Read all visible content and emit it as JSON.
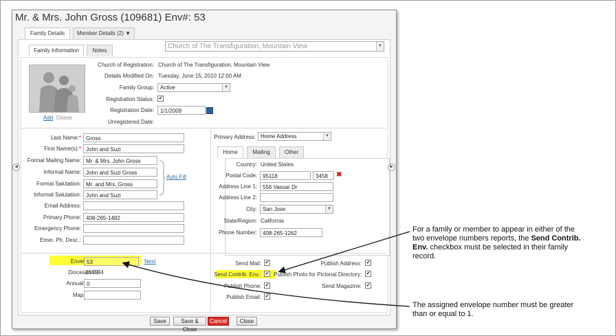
{
  "dialog": {
    "title": "Mr. & Mrs. John Gross (109681) Env#: 53",
    "tabs": [
      "Family Details",
      "Member Details (2)"
    ],
    "member_tab_caret": "▼",
    "subtabs": [
      "Family Information",
      "Notes"
    ],
    "church_select": "Church of The Transfiguration, Mountain View"
  },
  "registration": {
    "photo_links": [
      "Add",
      "Delete"
    ],
    "church_label": "Church of Registration:",
    "church_value": "Church of The Transfiguration, Mountain View",
    "modified_label": "Details Modified On:",
    "modified_value": "Tuesday, June 15, 2010 12:00 AM",
    "group_label": "Family Group:",
    "group_value": "Active",
    "status_label": "Registration Status:",
    "date_label": "Registration Date:",
    "date_value": "1/1/2009",
    "unreg_label": "Unregistered Date:"
  },
  "names": {
    "last_label": "Last Name:",
    "last_value": "Gross",
    "first_label": "First Name(s):",
    "first_value": "John and Suzi",
    "formal_mailing_label": "Formal Mailing Name:",
    "formal_mailing_value": "Mr. & Mrs. John Gross",
    "informal_name_label": "Informal Name:",
    "informal_name_value": "John and Suzi Gross",
    "formal_salutation_label": "Formal Salutation:",
    "formal_salutation_value": "Mr. and Mrs. Gross",
    "informal_salutation_label": "Informal Salutation:",
    "informal_salutation_value": "John and Suzi",
    "auto_fill": "Auto Fill",
    "email_label": "Email Address:",
    "phone_label": "Primary Phone:",
    "phone_value": "408-265-1482",
    "emergency_label": "Emergency Phone:",
    "emer_desc_label": "Emer. Ph. Desc.:"
  },
  "address": {
    "primary_label": "Primary Address:",
    "primary_value": "Home Address",
    "tabs": [
      "Home",
      "Mailing",
      "Other"
    ],
    "country_label": "Country:",
    "country_value": "United States",
    "postal_label": "Postal Code:",
    "postal_value": "95118",
    "postal_ext": "3458",
    "line1_label": "Address Line 1:",
    "line1_value": "556 Vassar Dr",
    "line2_label": "Address Line 2:",
    "city_label": "City:",
    "city_value": "San Jose",
    "state_label": "State/Region:",
    "state_value": "California",
    "phone_label": "Phone Number:",
    "phone_value": "408-265-1262"
  },
  "envelope": {
    "env_label": "Envelope #:",
    "env_value": "53",
    "next": "Next",
    "diocesan_label": "Diocesan ID:",
    "diocesan_value": "266594",
    "gift_label": "Annual Gift $:",
    "gift_value": "0",
    "map_label": "Map Code:"
  },
  "flags": {
    "send_mail": "Send Mail:",
    "send_contrib": "Send Contrib. Env.:",
    "publish_phone": "Publish Phone:",
    "publish_email": "Publish Email:",
    "publish_address": "Publish Address:",
    "publish_photo": "Publish Photo for Pictorial Directory:",
    "send_magazine": "Send Magazine:",
    "check": "✔"
  },
  "buttons": {
    "save": "Save",
    "save_close": "Save & Close",
    "cancel": "Cancel",
    "close": "Close"
  },
  "callouts": {
    "c1_pre": "For a family or member to appear in either of the two envelope numbers reports, the",
    "c1_bold": "Send Contrib. Env.",
    "c1_post": "checkbox must be selected in their family record.",
    "c2": "The assigned envelope number must be greater than or equal to 1."
  },
  "colors": {
    "highlight": "#ffff33",
    "cancel": "#d9302c",
    "link": "#2a6ea5"
  }
}
